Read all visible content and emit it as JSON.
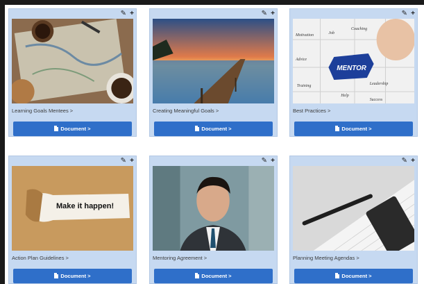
{
  "cards": [
    {
      "caption": "Learning Goals Mentees >",
      "button": "Document >",
      "image": "map-coffee-photo"
    },
    {
      "caption": "Creating Meaningful Goals >",
      "button": "Document >",
      "image": "pier-sunset-photo"
    },
    {
      "caption": "Best Practices >",
      "button": "Document >",
      "image": "mentor-puzzle-photo"
    },
    {
      "caption": "Action Plan Guidelines >",
      "button": "Document >",
      "image": "make-it-happen-photo"
    },
    {
      "caption": "Mentoring Agreement >",
      "button": "Document >",
      "image": "businessman-photo"
    },
    {
      "caption": "Planning Meeting Agendas >",
      "button": "Document >",
      "image": "notebook-pen-photo"
    }
  ],
  "tools": {
    "edit": "✎",
    "add": "+"
  },
  "image_text": {
    "make_it_happen": "Make it happen!",
    "mentor": "MENTOR",
    "puzzle_words": [
      "Motivation",
      "Job",
      "Coaching",
      "Advice",
      "Leadership",
      "Training",
      "Help",
      "Success"
    ]
  },
  "colors": {
    "card_bg": "#c6d9f1",
    "button_bg": "#2f6fc9",
    "button_text": "#ffffff"
  }
}
